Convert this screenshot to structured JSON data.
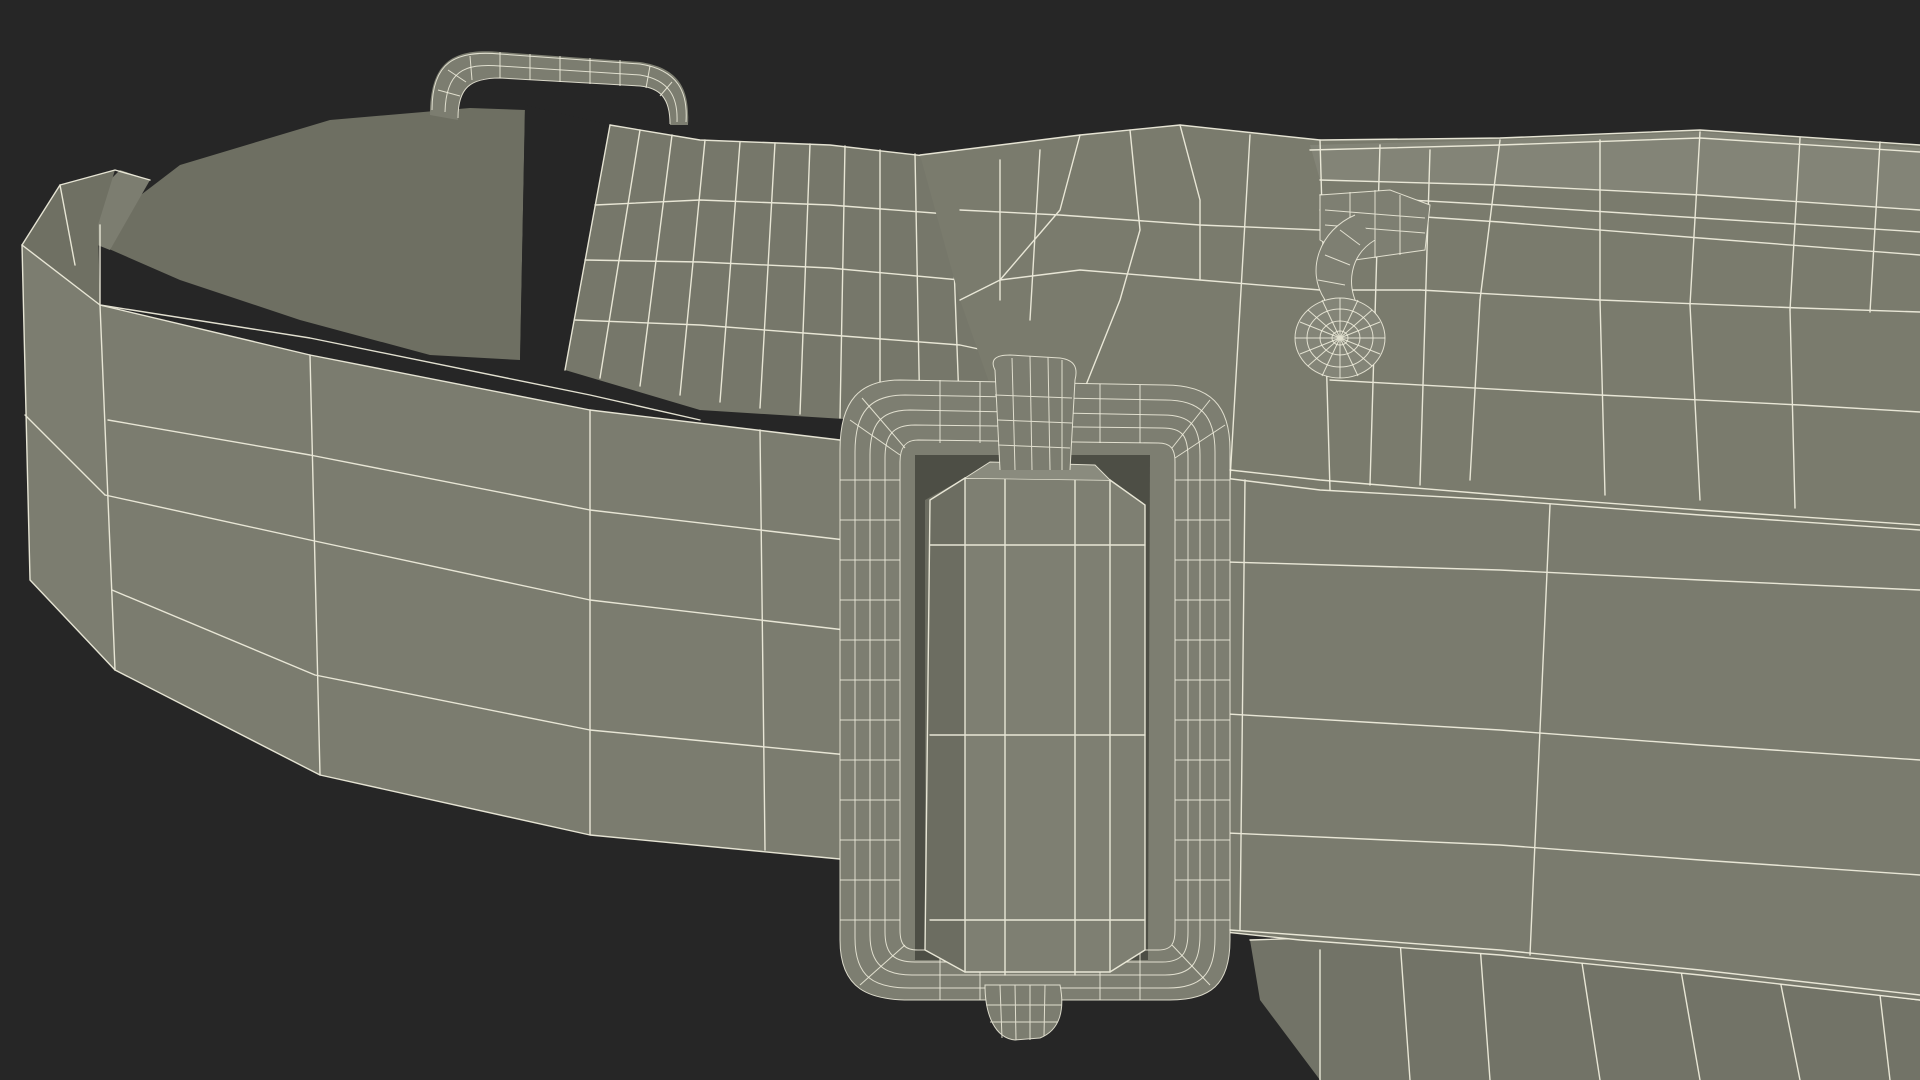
{
  "scene": {
    "subject": "",
    "background_color": "#262626",
    "surface_color": "#7a7b6d",
    "surface_shadow_color": "#626357",
    "surface_highlight_color": "#8a8b7d",
    "wireframe_color": "#f2f0df",
    "render_mode": "wireframe-on-shaded"
  }
}
